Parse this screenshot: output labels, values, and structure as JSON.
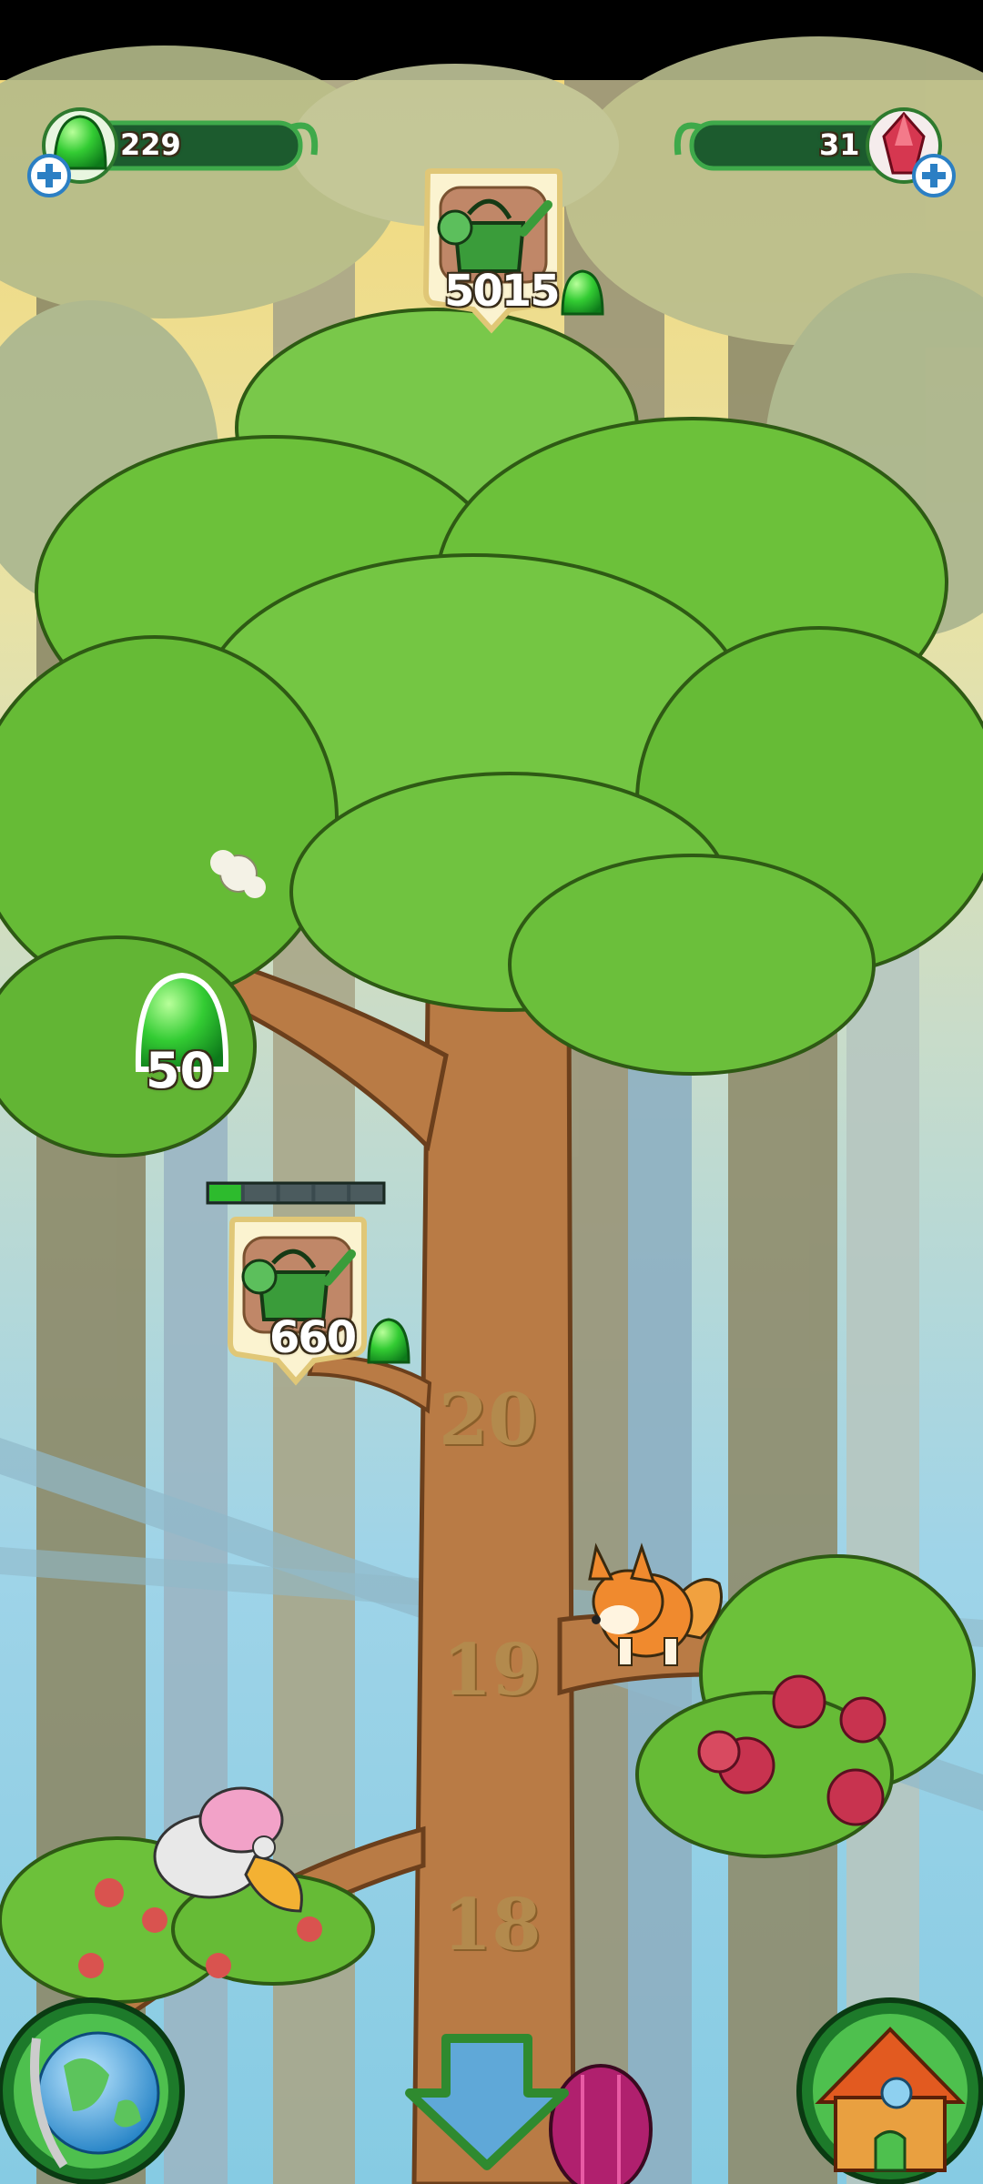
{
  "hud": {
    "gems_value": "229",
    "crystals_value": "31"
  },
  "top_upgrade": {
    "cost": "5015"
  },
  "side_upgrade": {
    "cost": "660",
    "progress_segments_total": 5,
    "progress_segments_filled": 1
  },
  "gem_drop": {
    "value": "50"
  },
  "tree_levels": [
    "20",
    "19",
    "18"
  ],
  "colors": {
    "accent_green": "#2dbb2d",
    "trunk": "#b97b45",
    "leaf": "#6cc13a",
    "sky": "#9fd4e8"
  }
}
